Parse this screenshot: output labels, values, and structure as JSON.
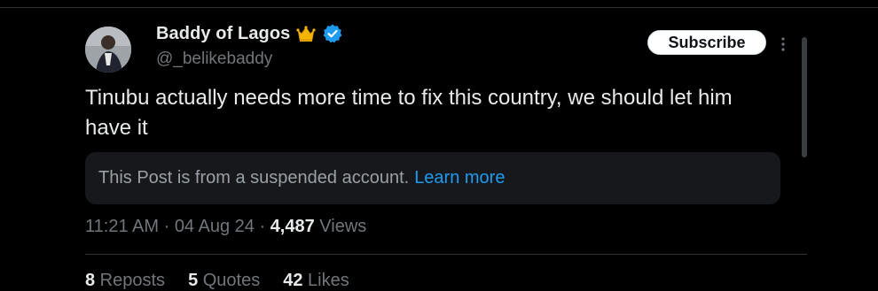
{
  "author": {
    "display_name": "Baddy of Lagos",
    "handle": "@_belikebaddy",
    "badge_icons": [
      "crown-icon",
      "verified-icon"
    ]
  },
  "header": {
    "subscribe_label": "Subscribe"
  },
  "post": {
    "text": "Tinubu actually needs more time to fix this country, we should let him have it"
  },
  "notice": {
    "text": "This Post is from a suspended account.",
    "link_label": "Learn more"
  },
  "meta": {
    "time": "11:21 AM",
    "sep1": " · ",
    "date": "04 Aug 24",
    "sep2": " · ",
    "views_count": "4,487",
    "views_label": " Views"
  },
  "stats": {
    "reposts_count": "8",
    "reposts_label": " Reposts",
    "quotes_count": "5",
    "quotes_label": " Quotes",
    "likes_count": "42",
    "likes_label": " Likes"
  },
  "colors": {
    "background": "#000000",
    "text_primary": "#e7e9ea",
    "text_secondary": "#71767b",
    "link": "#1d9bf0",
    "notice_bg": "#16181c",
    "verified": "#1d9bf0",
    "crown": "#f4b400"
  }
}
